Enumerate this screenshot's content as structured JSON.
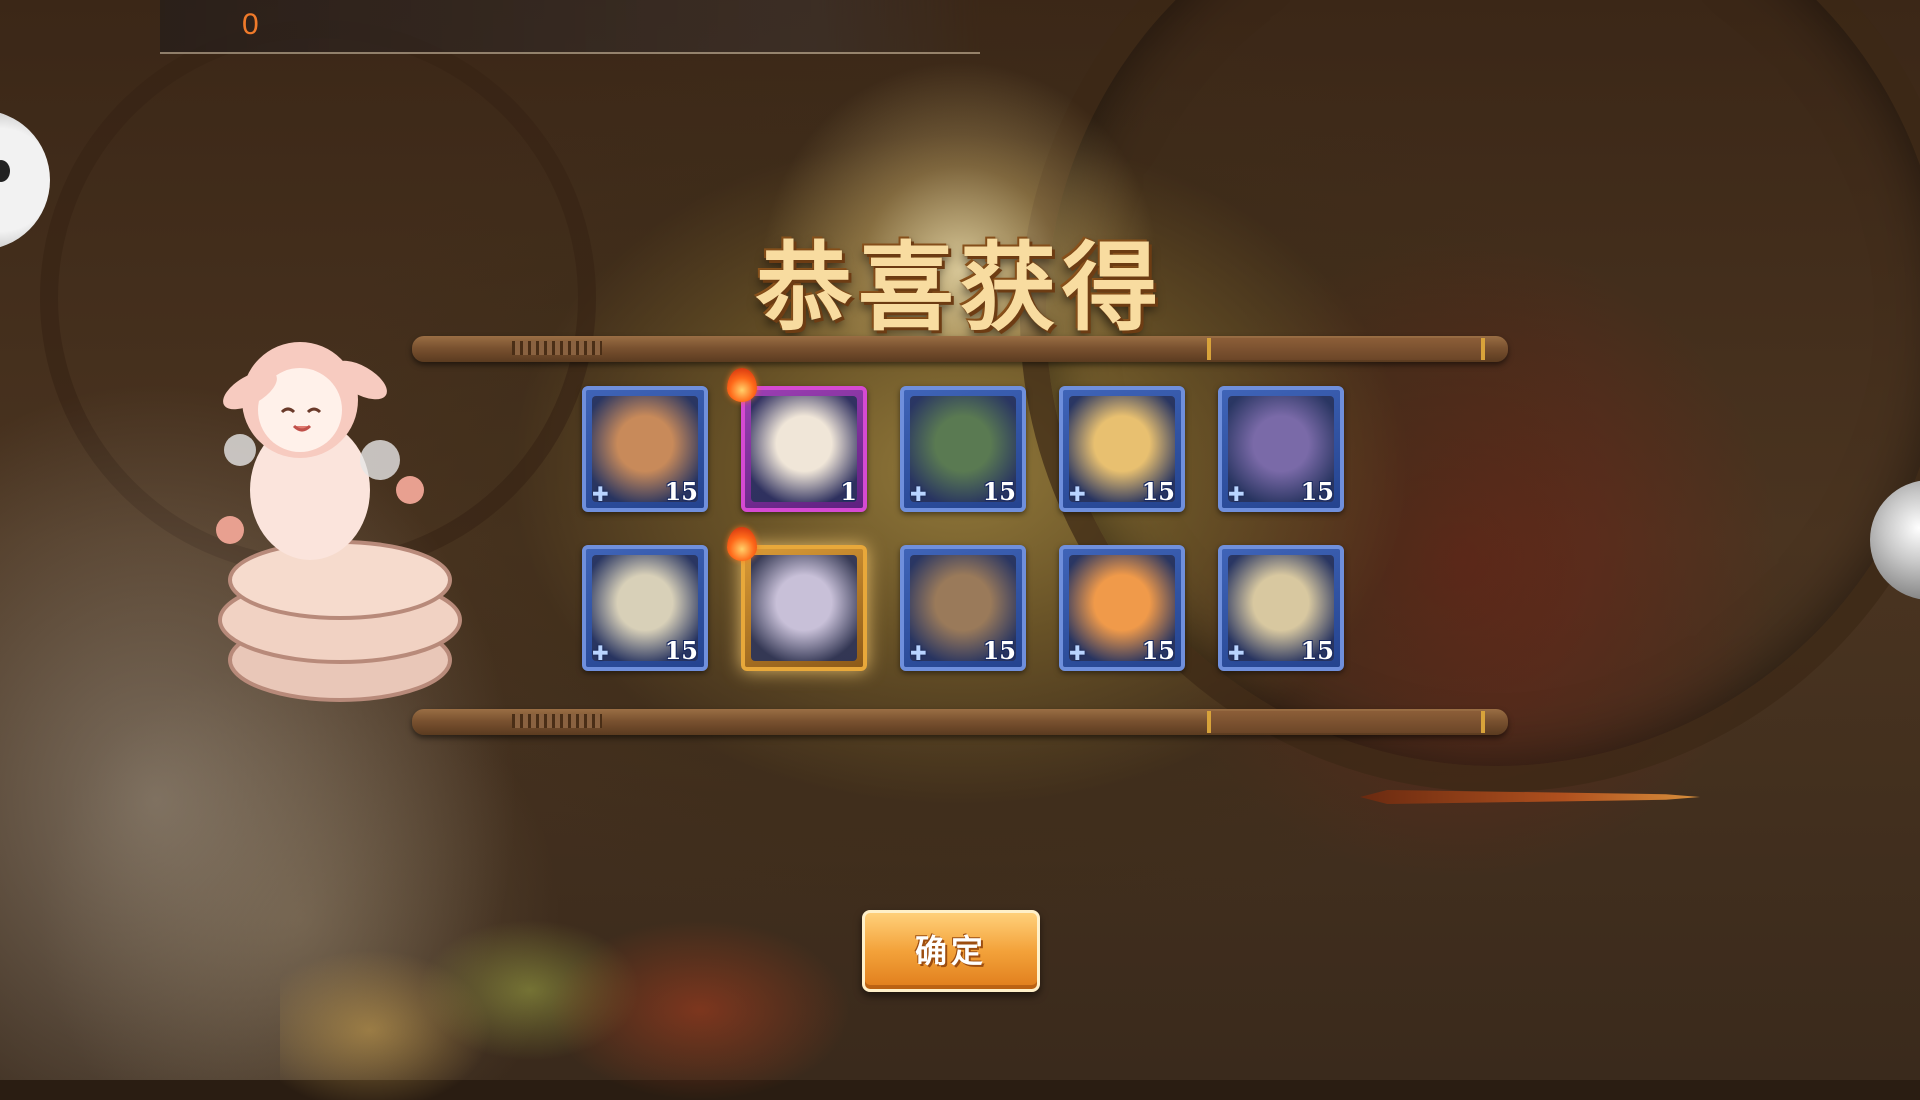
{
  "hud": {
    "top_counter": "0"
  },
  "dialog": {
    "title": "恭喜获得",
    "confirm_label": "确定"
  },
  "rewards": [
    {
      "count": "15",
      "rarity": "blue",
      "hot": false,
      "tint": "#c88a5a"
    },
    {
      "count": "1",
      "rarity": "purple",
      "hot": true,
      "tint": "#f0e6d8"
    },
    {
      "count": "15",
      "rarity": "blue",
      "hot": false,
      "tint": "#5a7a52"
    },
    {
      "count": "15",
      "rarity": "blue",
      "hot": false,
      "tint": "#e8c070"
    },
    {
      "count": "15",
      "rarity": "blue",
      "hot": false,
      "tint": "#7a6aa8"
    },
    {
      "count": "15",
      "rarity": "blue",
      "hot": false,
      "tint": "#d8d0b8"
    },
    {
      "count": "",
      "rarity": "gold",
      "hot": true,
      "tint": "#c8c0d8"
    },
    {
      "count": "15",
      "rarity": "blue",
      "hot": false,
      "tint": "#9a7a5a"
    },
    {
      "count": "15",
      "rarity": "blue",
      "hot": false,
      "tint": "#f09a4a"
    },
    {
      "count": "15",
      "rarity": "blue",
      "hot": false,
      "tint": "#d8c8a0"
    }
  ],
  "icons": {
    "fragment": "puzzle-icon",
    "hot": "flame-icon"
  }
}
